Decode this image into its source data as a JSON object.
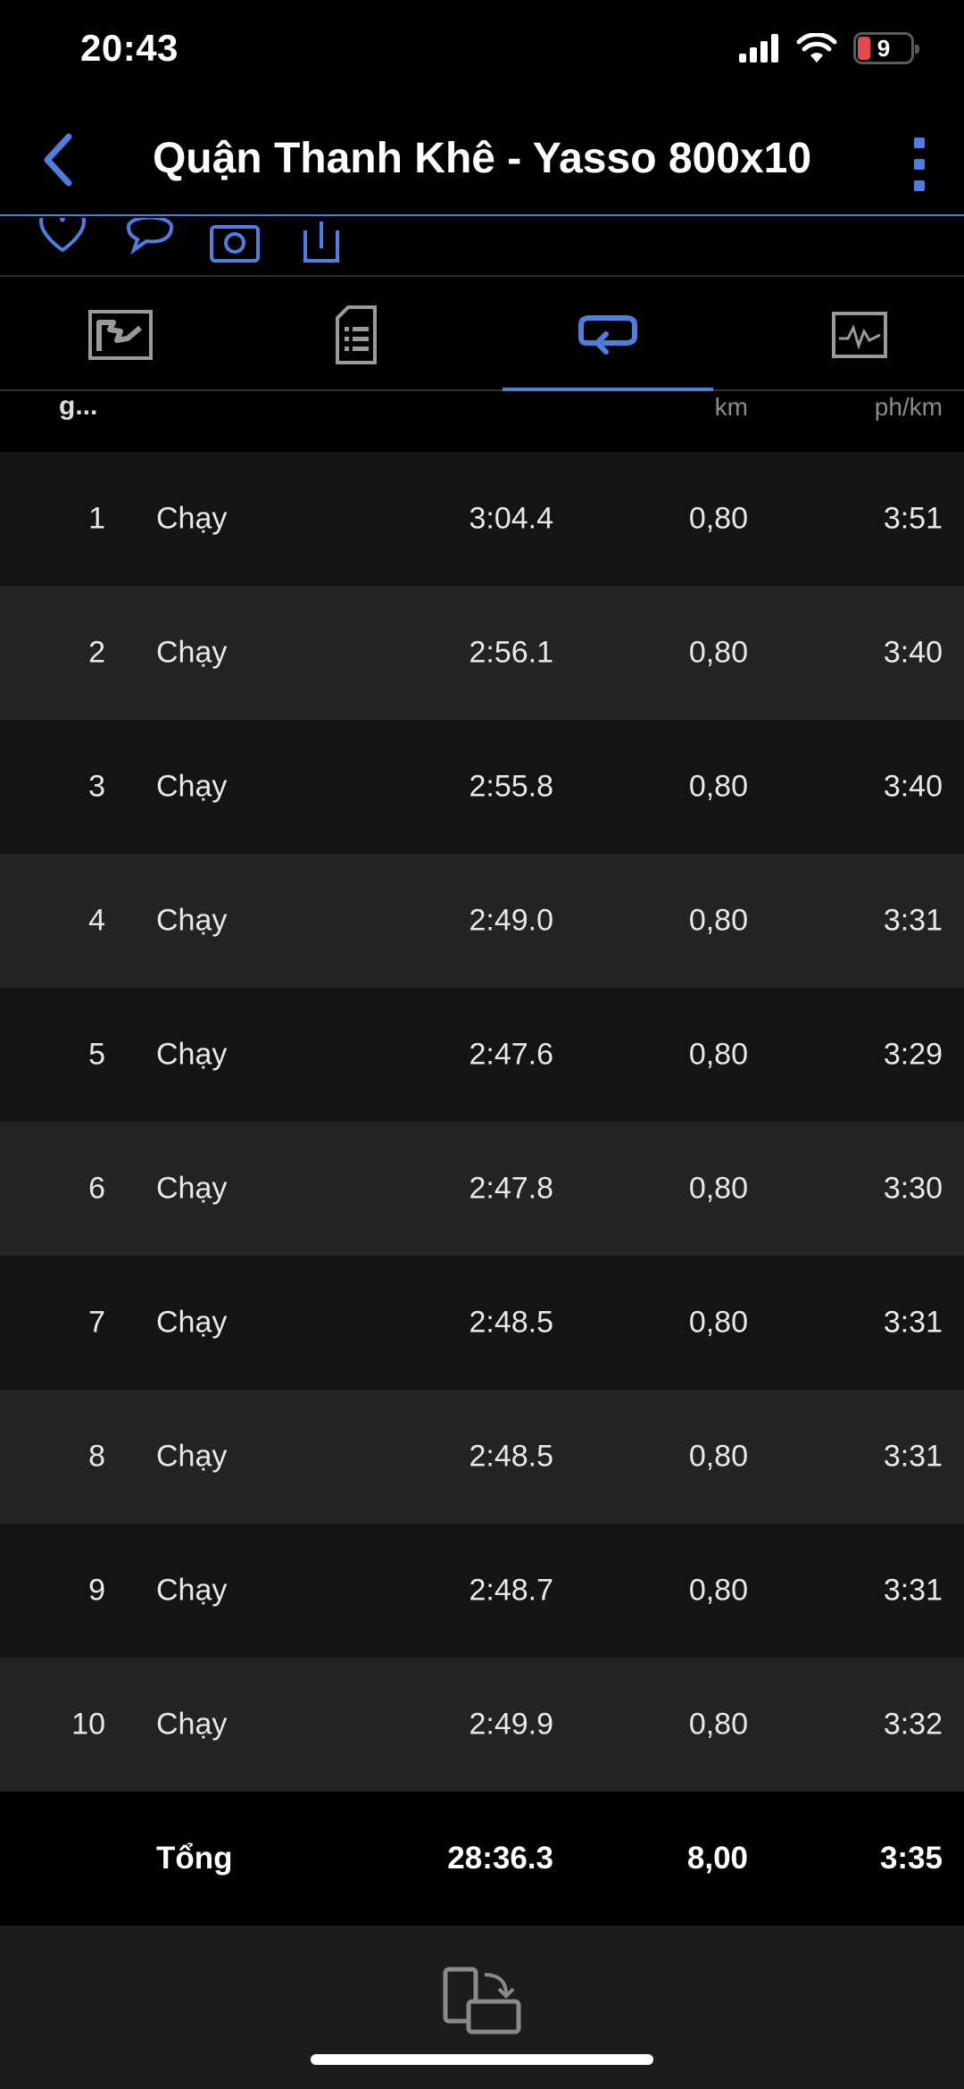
{
  "status_bar": {
    "time": "20:43",
    "battery": "9"
  },
  "nav": {
    "title": "Quận Thanh Khê - Yasso 800x10"
  },
  "table": {
    "headers": {
      "lap": "g...",
      "distance": "km",
      "pace": "ph/km"
    },
    "rows": [
      {
        "n": "1",
        "type": "Chạy",
        "time": "3:04.4",
        "dist": "0,80",
        "pace": "3:51"
      },
      {
        "n": "2",
        "type": "Chạy",
        "time": "2:56.1",
        "dist": "0,80",
        "pace": "3:40"
      },
      {
        "n": "3",
        "type": "Chạy",
        "time": "2:55.8",
        "dist": "0,80",
        "pace": "3:40"
      },
      {
        "n": "4",
        "type": "Chạy",
        "time": "2:49.0",
        "dist": "0,80",
        "pace": "3:31"
      },
      {
        "n": "5",
        "type": "Chạy",
        "time": "2:47.6",
        "dist": "0,80",
        "pace": "3:29"
      },
      {
        "n": "6",
        "type": "Chạy",
        "time": "2:47.8",
        "dist": "0,80",
        "pace": "3:30"
      },
      {
        "n": "7",
        "type": "Chạy",
        "time": "2:48.5",
        "dist": "0,80",
        "pace": "3:31"
      },
      {
        "n": "8",
        "type": "Chạy",
        "time": "2:48.5",
        "dist": "0,80",
        "pace": "3:31"
      },
      {
        "n": "9",
        "type": "Chạy",
        "time": "2:48.7",
        "dist": "0,80",
        "pace": "3:31"
      },
      {
        "n": "10",
        "type": "Chạy",
        "time": "2:49.9",
        "dist": "0,80",
        "pace": "3:32"
      }
    ],
    "total": {
      "label": "Tổng",
      "time": "28:36.3",
      "dist": "8,00",
      "pace": "3:35"
    }
  },
  "colors": {
    "accent": "#4f7ee0",
    "row_dark": "#141414",
    "row_light": "#232323",
    "battery_low": "#e5484d"
  },
  "icons": {
    "tabs": [
      "map-icon",
      "document-list-icon",
      "laps-loop-icon",
      "chart-icon"
    ],
    "actions": [
      "heart-icon",
      "comment-icon",
      "camera-icon",
      "share-icon"
    ]
  }
}
